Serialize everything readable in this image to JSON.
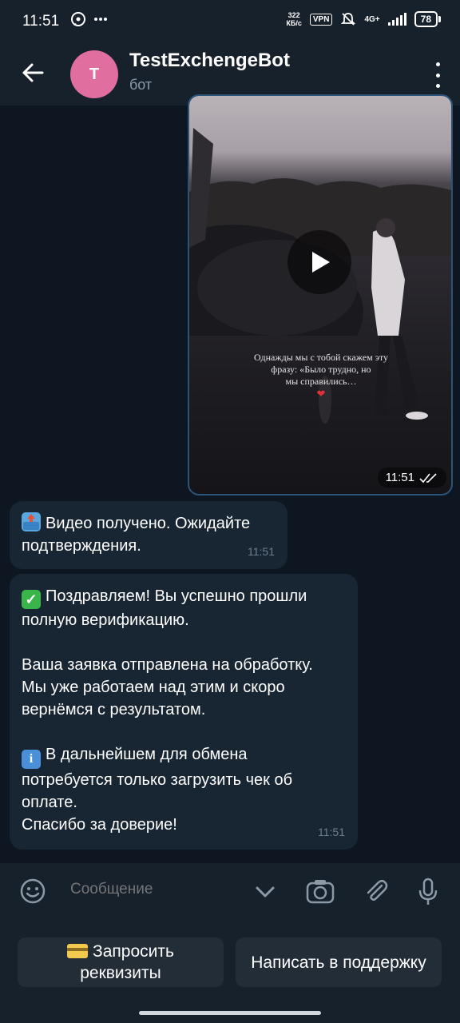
{
  "status_bar": {
    "time": "11:51",
    "net_speed_value": "322",
    "net_speed_unit": "КБ/с",
    "vpn": "VPN",
    "network": "4G+",
    "battery": "78",
    "icons": [
      "whatsapp-icon",
      "more-icon",
      "mute-icon",
      "signal-icon"
    ]
  },
  "header": {
    "avatar_letter": "T",
    "title": "TestExchengeBot",
    "subtitle": "бот",
    "avatar_color": "#e06e9f"
  },
  "video_message": {
    "caption_line1": "Однажды мы с тобой скажем эту",
    "caption_line2": "фразу: «Было трудно, но",
    "caption_line3": "мы справились…",
    "caption_heart": "❤",
    "time": "11:51",
    "status": "read"
  },
  "messages": [
    {
      "emoji": "inbox-tray",
      "text": "Видео получено. Ожидайте\nподтверждения.",
      "time": "11:51"
    },
    {
      "emoji": "check-mark",
      "text_part1": "Поздравляем! Вы успешно прошли\nполную верификацию.\n\nВаша заявка отправлена на обработку.\nМы уже работаем над этим и скоро\nвернёмся с результатом.\n\n",
      "info_emoji": "i",
      "text_part2": "В дальнейшем для обмена\nпотребуется только загрузить чек об\nоплате.\nСпасибо за доверие!",
      "time": "11:51"
    }
  ],
  "composer": {
    "placeholder": "Сообщение"
  },
  "keyboard": {
    "button1_line1": "Запросить",
    "button1_line2": "реквизиты",
    "button1_emoji": "credit-card",
    "button2": "Написать в поддержку"
  },
  "colors": {
    "background": "#0e1621",
    "header": "#17212b",
    "bubble": "#182533",
    "accent": "#2b5278",
    "muted_text": "#6d7f8f"
  }
}
